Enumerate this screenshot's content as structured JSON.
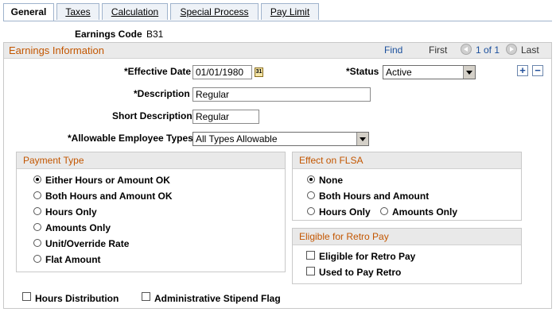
{
  "tabs": [
    "General",
    "Taxes",
    "Calculation",
    "Special Process",
    "Pay Limit"
  ],
  "earnings_code": {
    "label": "Earnings Code",
    "value": "B31"
  },
  "earnings_info": {
    "title": "Earnings Information",
    "find": "Find",
    "first": "First",
    "pager": "1 of 1",
    "last": "Last"
  },
  "effective_date": {
    "label": "*Effective Date",
    "value": "01/01/1980",
    "calendar_icon": "31"
  },
  "status": {
    "label": "*Status",
    "value": "Active"
  },
  "description": {
    "label": "*Description",
    "value": "Regular"
  },
  "short_description": {
    "label": "Short Description",
    "value": "Regular"
  },
  "allowable_types": {
    "label": "*Allowable Employee Types",
    "value": "All Types Allowable"
  },
  "payment_type": {
    "title": "Payment Type",
    "options": [
      "Either Hours or Amount OK",
      "Both Hours and Amount OK",
      "Hours Only",
      "Amounts Only",
      "Unit/Override Rate",
      "Flat Amount"
    ],
    "selected": "Either Hours or Amount OK"
  },
  "flsa": {
    "title": "Effect on FLSA",
    "options": [
      "None",
      "Both Hours and Amount",
      "Hours Only",
      "Amounts Only"
    ],
    "selected": "None"
  },
  "retro": {
    "title": "Eligible for Retro Pay",
    "options": [
      "Eligible for Retro Pay",
      "Used to Pay Retro"
    ]
  },
  "bottom_checks": [
    "Hours Distribution",
    "Administrative Stipend Flag"
  ]
}
